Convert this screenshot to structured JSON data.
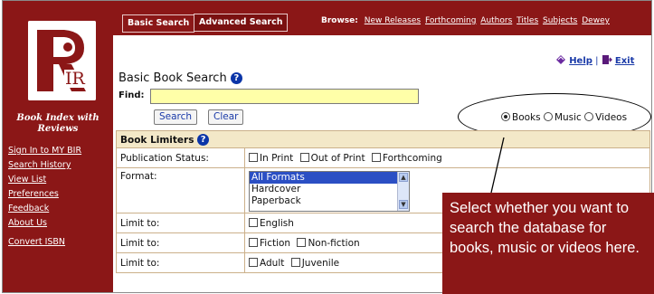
{
  "sidebar": {
    "logo_text": "IR",
    "tagline": "Book Index with Reviews",
    "nav": [
      "Sign In to MY BIR",
      "Search History",
      "View List",
      "Preferences",
      "Feedback",
      "About Us",
      "Convert ISBN"
    ]
  },
  "tabs": [
    "Basic Search",
    "Advanced Search"
  ],
  "browse": {
    "label": "Browse:",
    "links": [
      "New Releases",
      "Forthcoming",
      "Authors",
      "Titles",
      "Subjects",
      "Dewey"
    ]
  },
  "help": {
    "help_label": "Help",
    "separator": "|",
    "exit_label": "Exit"
  },
  "title": "Basic Book Search",
  "search": {
    "find_label": "Find:",
    "value": "",
    "search_button": "Search",
    "clear_button": "Clear"
  },
  "media": {
    "options": [
      "Books",
      "Music",
      "Videos"
    ],
    "selected": "Books"
  },
  "limiters": {
    "heading": "Book Limiters",
    "publication_status": {
      "label": "Publication Status:",
      "options": [
        "In Print",
        "Out of Print",
        "Forthcoming"
      ]
    },
    "format": {
      "label": "Format:",
      "options": [
        "All Formats",
        "Hardcover",
        "Paperback"
      ],
      "selected": "All Formats"
    },
    "limit_rows": [
      {
        "label": "Limit to:",
        "options": [
          "English"
        ]
      },
      {
        "label": "Limit to:",
        "options": [
          "Fiction",
          "Non-fiction"
        ]
      },
      {
        "label": "Limit to:",
        "options": [
          "Adult",
          "Juvenile"
        ]
      }
    ]
  },
  "callout": "Select whether you want to search the database for books, music or videos here.",
  "colors": {
    "brand_red": "#8b1717",
    "link_blue": "#1a3aa8",
    "find_bg": "#ffffa8",
    "table_head": "#f3e8c8"
  }
}
